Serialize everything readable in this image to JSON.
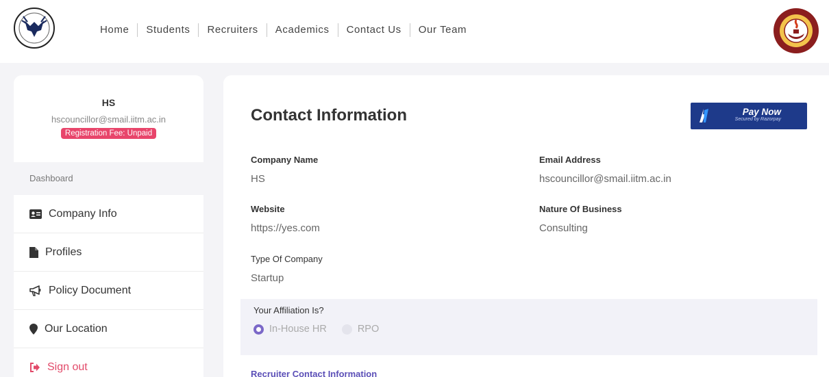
{
  "nav": {
    "items": [
      "Home",
      "Students",
      "Recruiters",
      "Academics",
      "Contact Us",
      "Our Team"
    ]
  },
  "logos": {
    "left_icon": "placement-cell-logo",
    "right_icon": "institute-seal-logo"
  },
  "sidebar": {
    "profile_name": "HS",
    "profile_email": "hscouncillor@smail.iitm.ac.in",
    "fee_badge": "Registration Fee: Unpaid",
    "section_label": "Dashboard",
    "items": [
      {
        "label": "Company Info",
        "icon": "id-card-icon"
      },
      {
        "label": "Profiles",
        "icon": "file-icon"
      },
      {
        "label": "Policy Document",
        "icon": "megaphone-icon"
      },
      {
        "label": "Our Location",
        "icon": "map-pin-icon"
      },
      {
        "label": "Sign out",
        "icon": "sign-out-icon"
      }
    ]
  },
  "main": {
    "title": "Contact Information",
    "pay_button": {
      "label": "Pay Now",
      "sub": "Secured by Razorpay"
    },
    "fields": {
      "company_name": {
        "label": "Company Name",
        "value": "HS"
      },
      "email": {
        "label": "Email Address",
        "value": "hscouncillor@smail.iitm.ac.in"
      },
      "website": {
        "label": "Website",
        "value": "https://yes.com"
      },
      "nature": {
        "label": "Nature Of Business",
        "value": "Consulting"
      },
      "type": {
        "label": "Type Of Company",
        "value": "Startup"
      }
    },
    "affiliation": {
      "label": "Your Affiliation Is?",
      "options": [
        "In-House HR",
        "RPO"
      ],
      "selected": "In-House HR"
    },
    "recruiter_section": "Recruiter Contact Information"
  },
  "colors": {
    "accent": "#5b4fb7",
    "badge": "#e8456b",
    "pay_button": "#1e3a8a",
    "signout": "#e24a6a"
  }
}
